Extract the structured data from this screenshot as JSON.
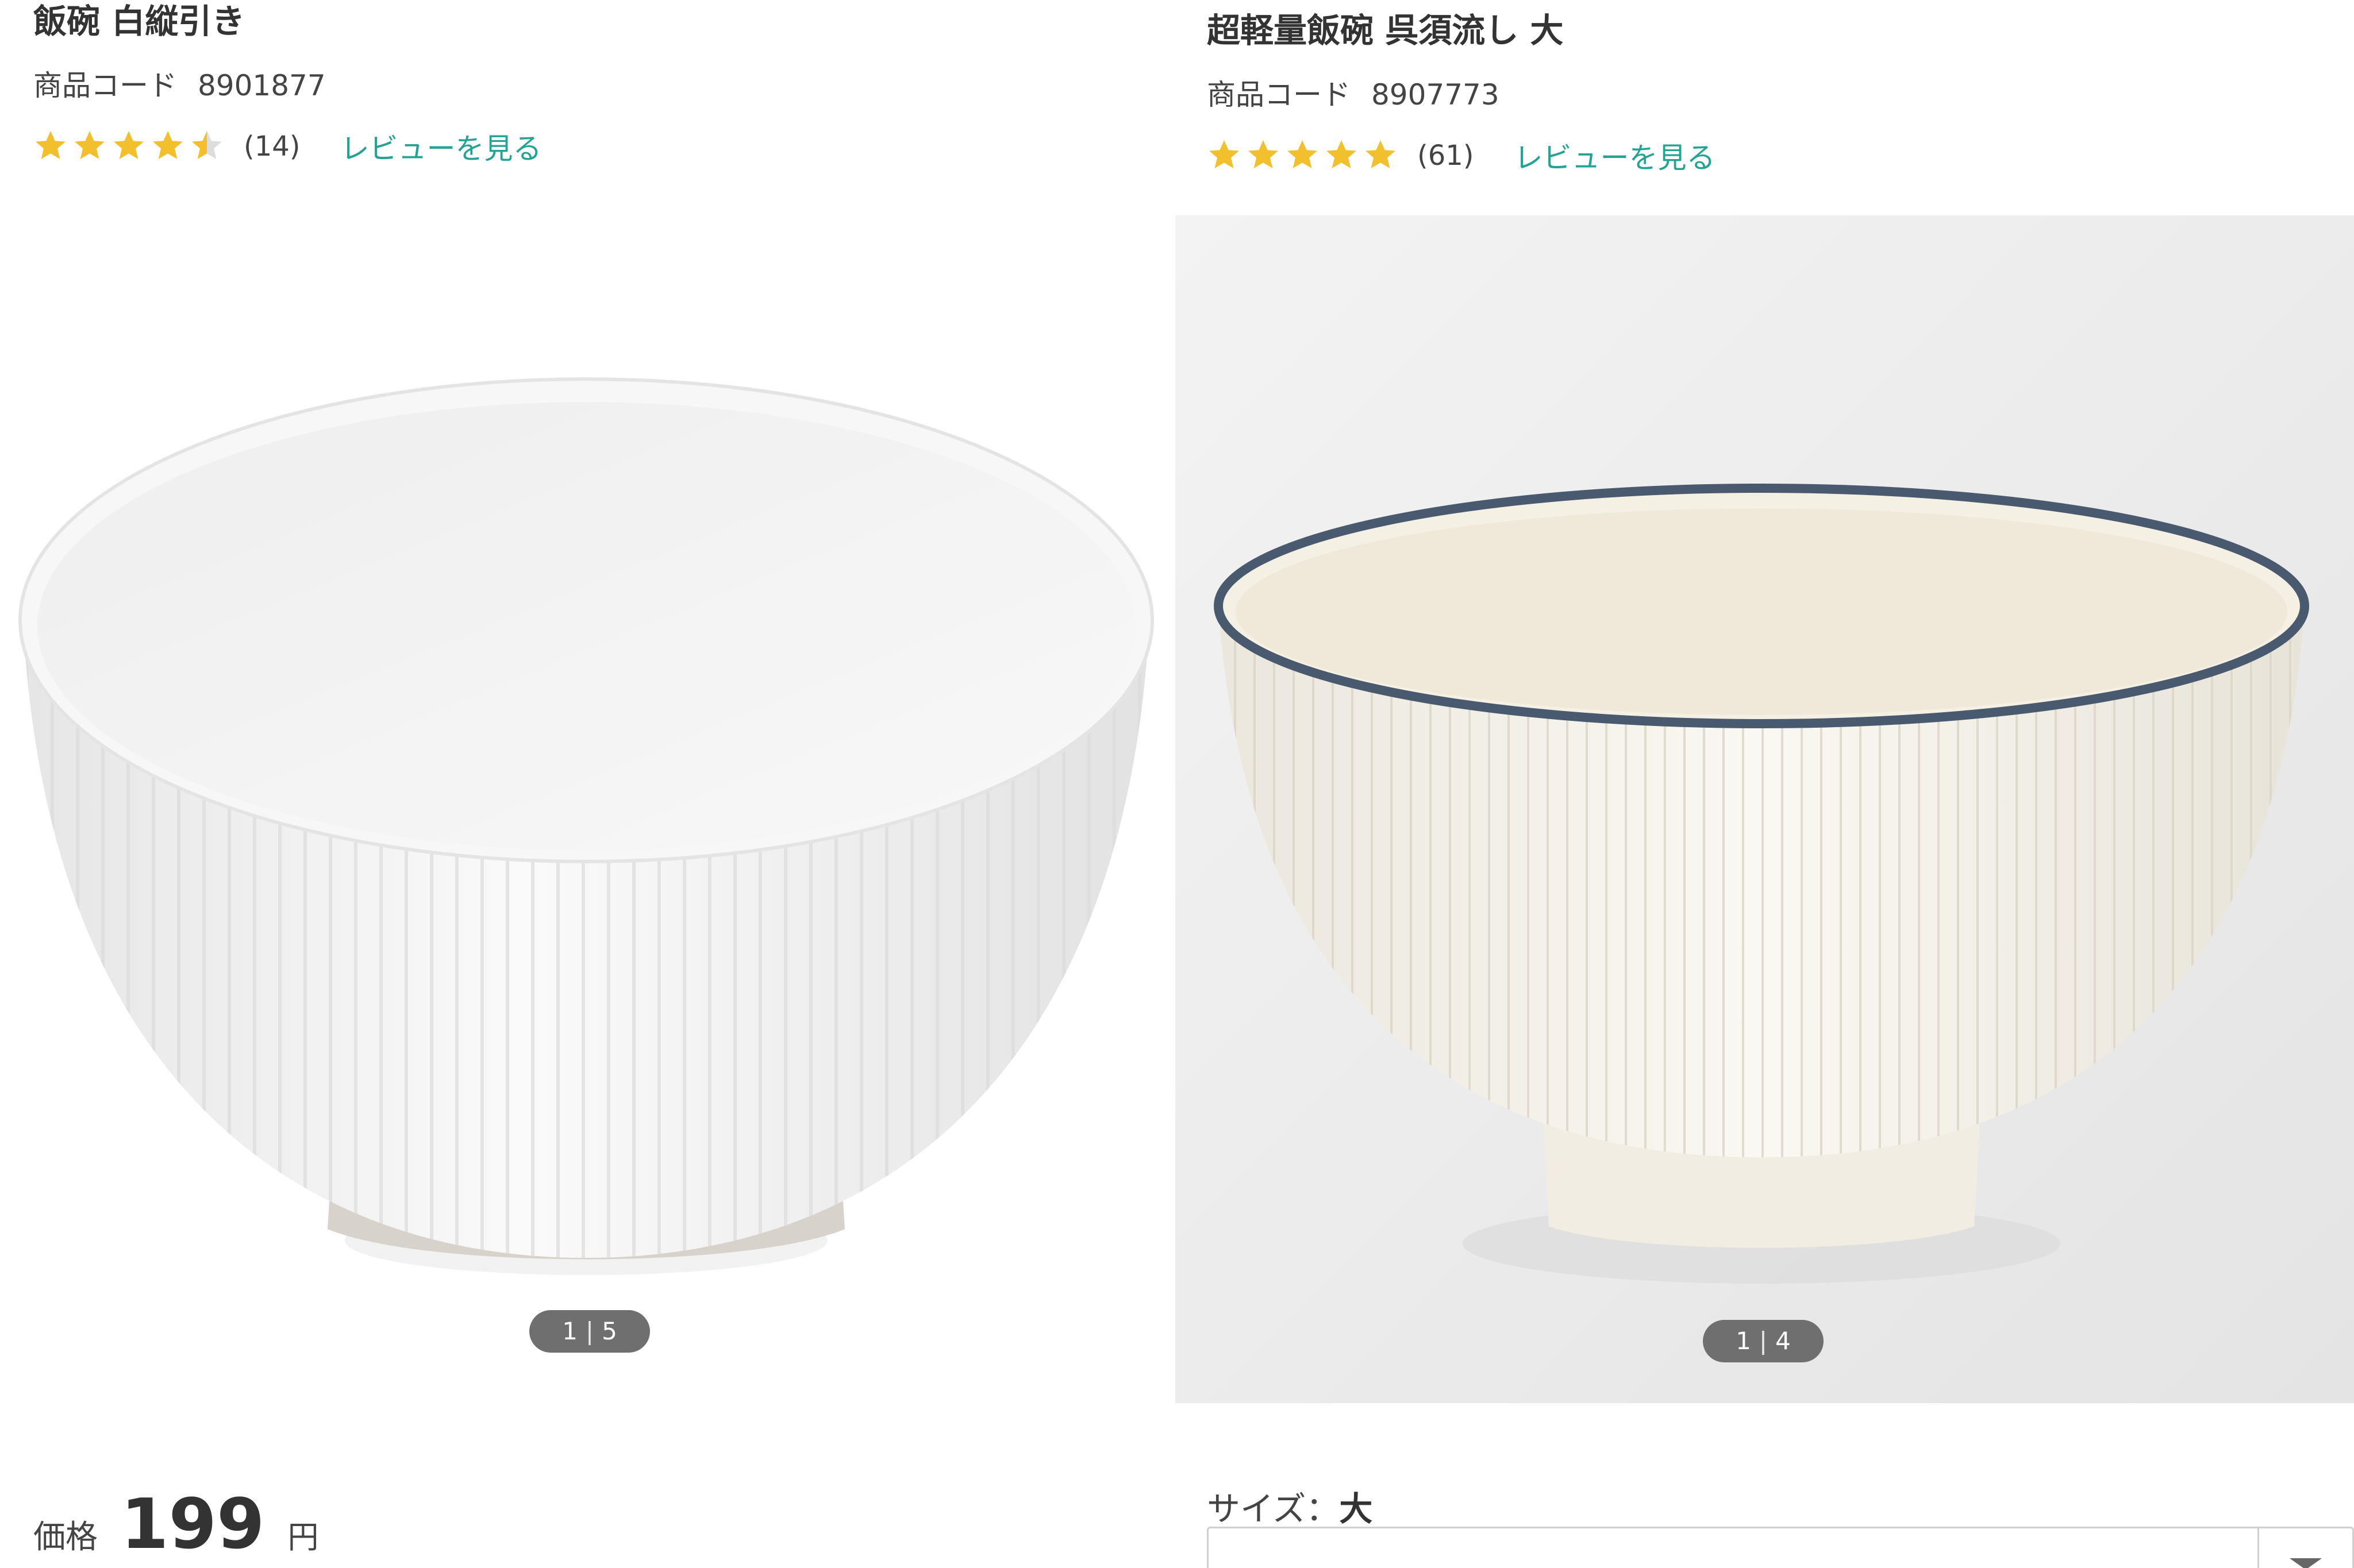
{
  "products": [
    {
      "title": "飯碗 白縦引き",
      "code_label": "商品コード",
      "code_value": "8901877",
      "rating": 4.5,
      "review_count": "(14)",
      "review_link": "レビューを見る",
      "pager": {
        "current": "1",
        "separator": "|",
        "total": "5"
      },
      "price": {
        "label": "価格",
        "value": "199",
        "unit": "円"
      }
    },
    {
      "title": "超軽量飯碗 呉須流し 大",
      "code_label": "商品コード",
      "code_value": "8907773",
      "rating": 5,
      "review_count": "(61)",
      "review_link": "レビューを見る",
      "pager": {
        "current": "1",
        "separator": "|",
        "total": "4"
      },
      "size": {
        "label": "サイズ：",
        "value": "大"
      }
    }
  ],
  "colors": {
    "star": "#f2c02d",
    "star_empty": "#dddddd",
    "link": "#23a394",
    "pager_bg": "#6f6f6f",
    "photo_bg_right": "#eeeeee"
  },
  "icons": {
    "star": "star-icon",
    "select_arrow": "chevron-down-icon"
  }
}
